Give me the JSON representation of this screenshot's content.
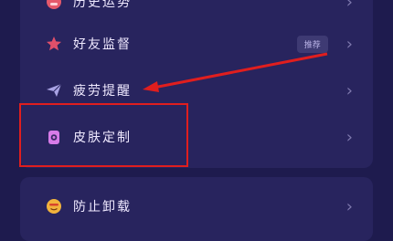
{
  "items": [
    {
      "label": "历史运势",
      "icon": "avatar-icon"
    },
    {
      "label": "好友监督",
      "icon": "star-icon",
      "badge": "推荐"
    },
    {
      "label": "疲劳提醒",
      "icon": "paper-plane-icon"
    },
    {
      "label": "皮肤定制",
      "icon": "skin-icon"
    },
    {
      "label": "防止卸载",
      "icon": "emoji-icon"
    }
  ],
  "chevron": "›",
  "colors": {
    "background": "#1e1b4e",
    "card": "#28245e",
    "annotation": "#e01e1e"
  }
}
